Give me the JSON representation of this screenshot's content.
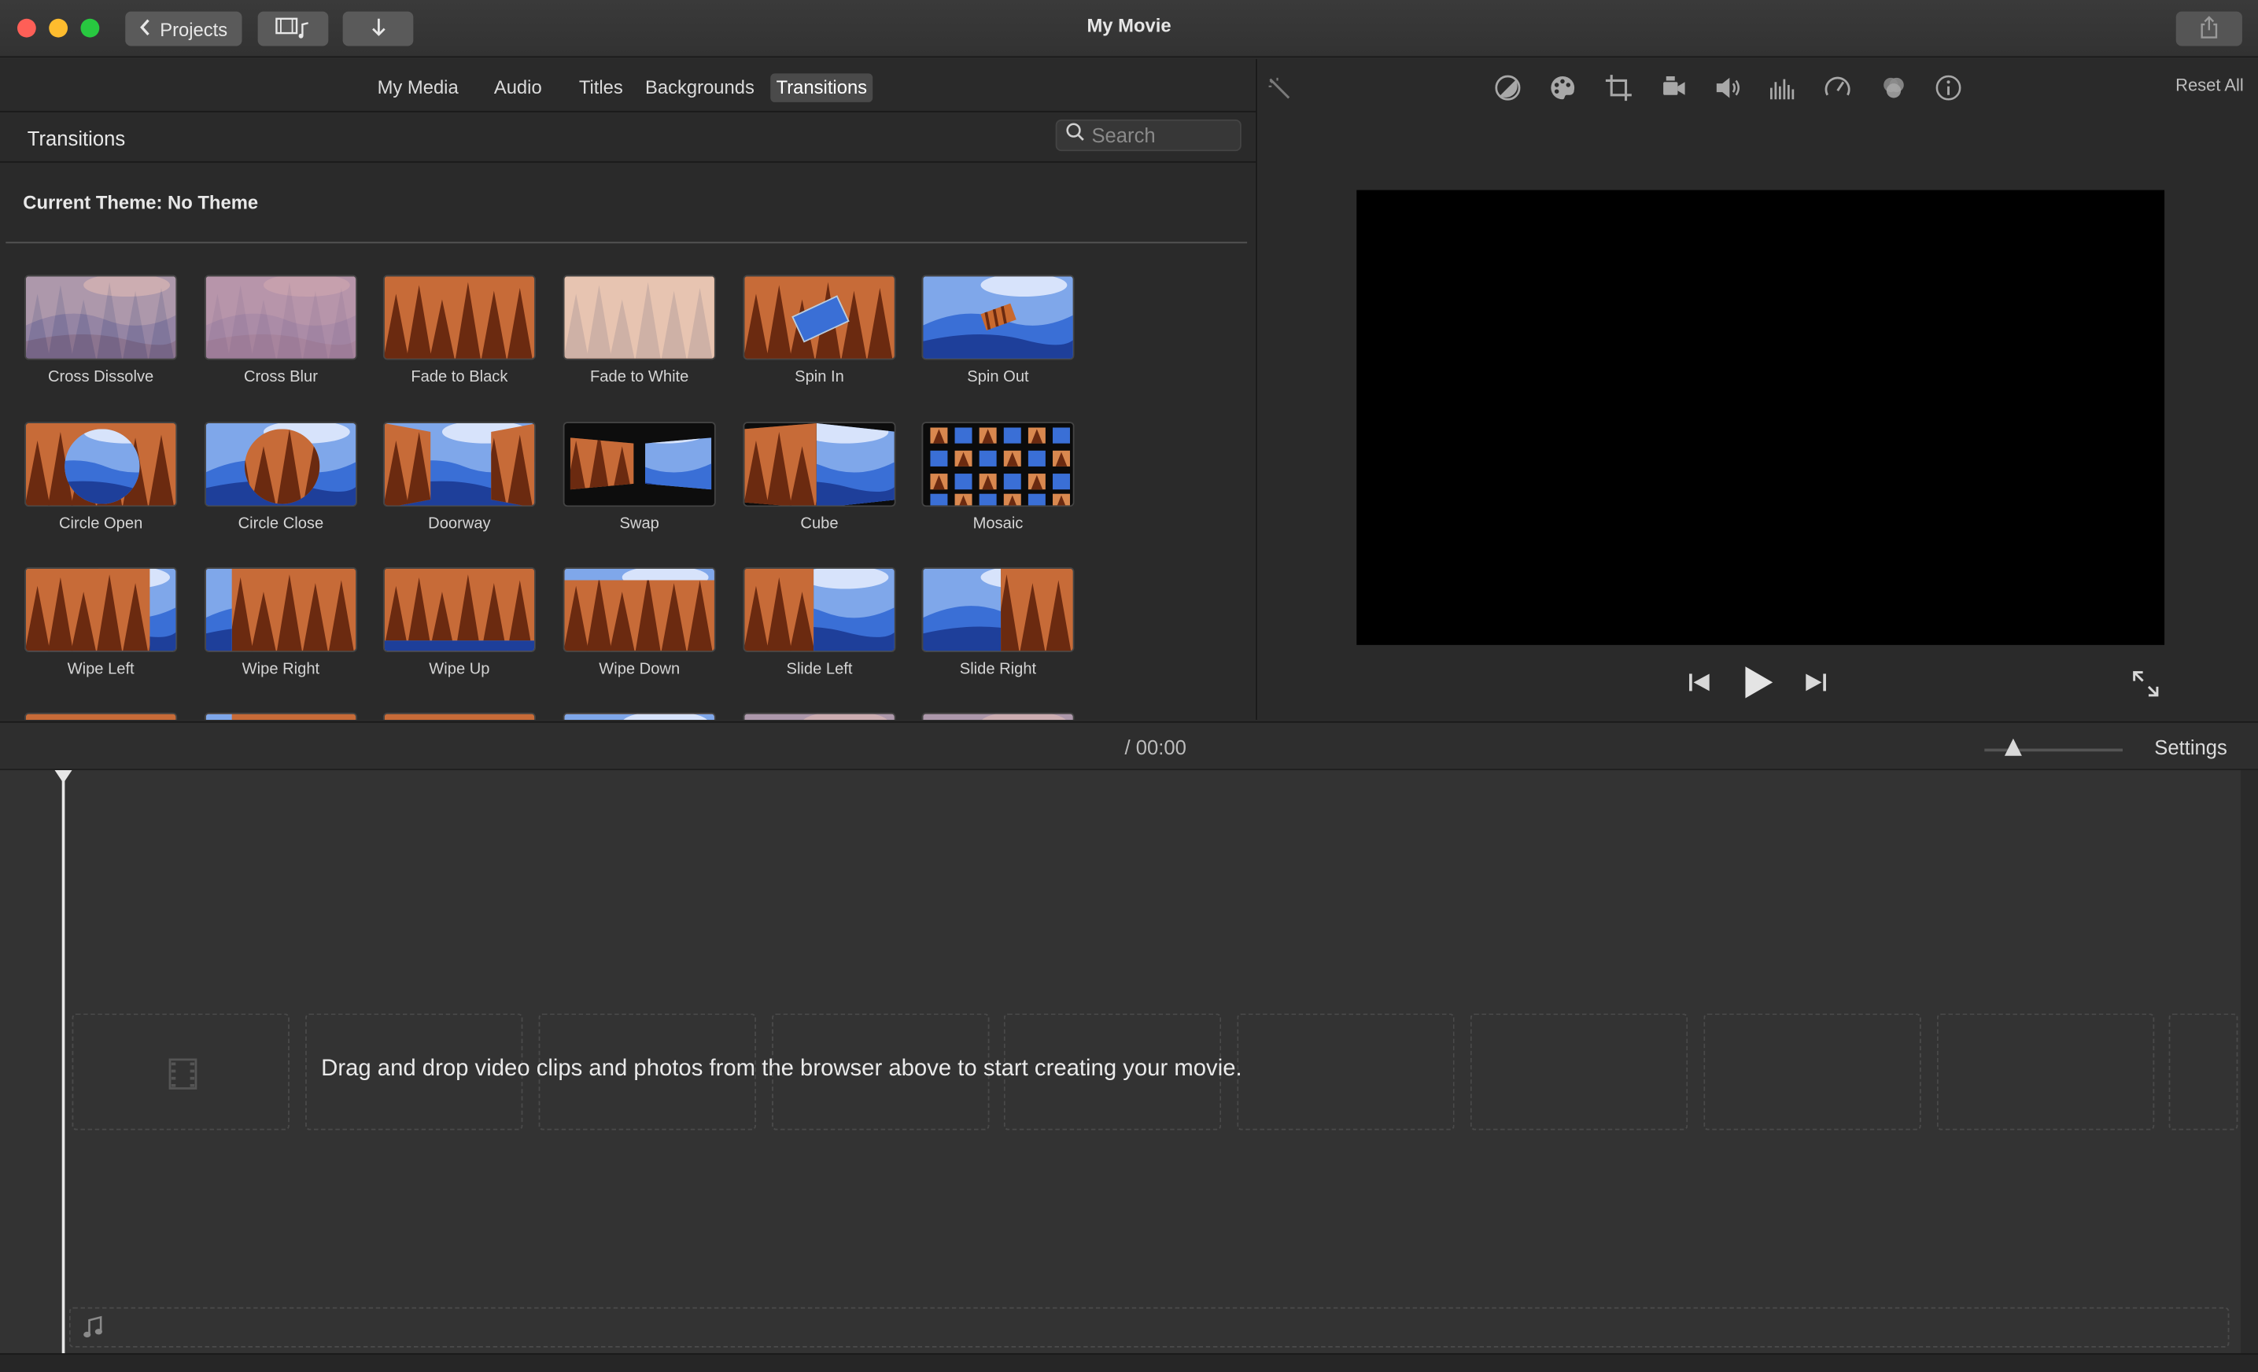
{
  "window": {
    "title": "My Movie",
    "projects_button": "Projects"
  },
  "browser": {
    "tabs": [
      {
        "label": "My Media"
      },
      {
        "label": "Audio"
      },
      {
        "label": "Titles"
      },
      {
        "label": "Backgrounds"
      },
      {
        "label": "Transitions",
        "active": true
      }
    ],
    "section_title": "Transitions",
    "search_placeholder": "Search",
    "current_theme": "Current Theme: No Theme",
    "transitions": [
      {
        "label": "Cross Dissolve",
        "style": "dissolve"
      },
      {
        "label": "Cross Blur",
        "style": "blur"
      },
      {
        "label": "Fade to Black",
        "style": "forest"
      },
      {
        "label": "Fade to White",
        "style": "white"
      },
      {
        "label": "Spin In",
        "style": "spin-in"
      },
      {
        "label": "Spin Out",
        "style": "spin-out"
      },
      {
        "label": "Circle Open",
        "style": "circle-open"
      },
      {
        "label": "Circle Close",
        "style": "circle-close"
      },
      {
        "label": "Doorway",
        "style": "doorway"
      },
      {
        "label": "Swap",
        "style": "swap"
      },
      {
        "label": "Cube",
        "style": "cube"
      },
      {
        "label": "Mosaic",
        "style": "mosaic"
      },
      {
        "label": "Wipe Left",
        "style": "wipe-left"
      },
      {
        "label": "Wipe Right",
        "style": "wipe-right"
      },
      {
        "label": "Wipe Up",
        "style": "wipe-up"
      },
      {
        "label": "Wipe Down",
        "style": "wipe-down"
      },
      {
        "label": "Slide Left",
        "style": "slide-left"
      },
      {
        "label": "Slide Right",
        "style": "slide-right"
      }
    ]
  },
  "viewer": {
    "reset_all": "Reset All",
    "toolbar_icons": [
      "magic-wand-icon",
      "color-balance-icon",
      "color-palette-icon",
      "crop-icon",
      "stabilization-icon",
      "volume-icon",
      "equalizer-icon",
      "speed-icon",
      "overlay-icon",
      "info-icon"
    ]
  },
  "timeline": {
    "timecode": "/  00:00",
    "settings": "Settings",
    "drop_hint": "Drag and drop video clips and photos from the browser above to start creating your movie."
  },
  "colors": {
    "forest_sky": "#d9884f",
    "forest_tree": "#6b2a10",
    "mountain_sky": "#3a6fd6",
    "mountain_dark": "#1e3f9a"
  }
}
